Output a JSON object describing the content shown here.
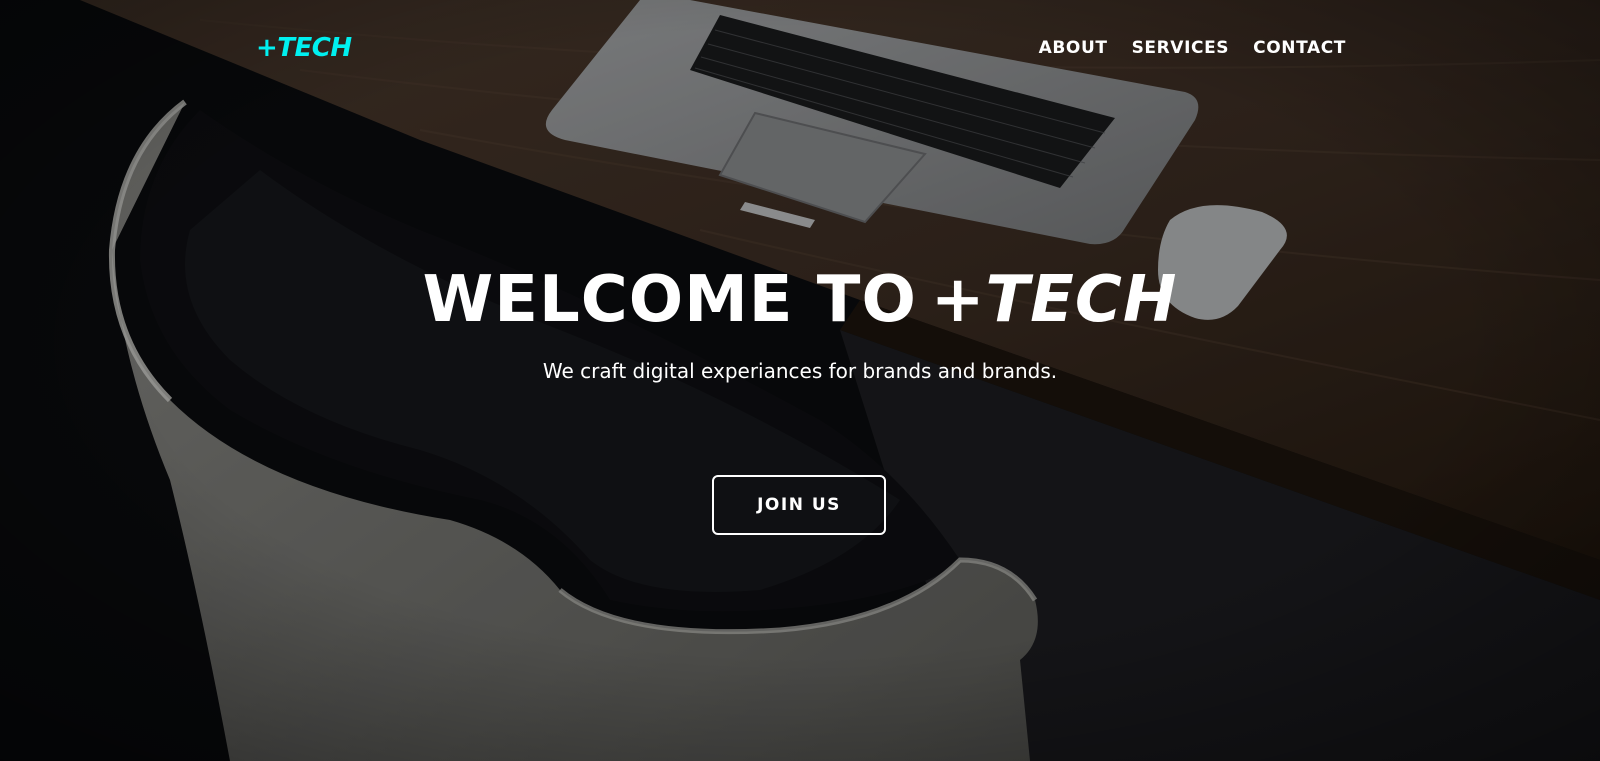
{
  "header": {
    "logo": "+TECH",
    "logo_color": "#00f0f0",
    "nav": [
      {
        "label": "ABOUT"
      },
      {
        "label": "SERVICES"
      },
      {
        "label": "CONTACT"
      }
    ]
  },
  "hero": {
    "title_prefix": "WELCOME TO",
    "title_brand": "+TECH",
    "subtitle": "We craft digital experiances for brands and brands.",
    "cta_label": "JOIN US"
  },
  "colors": {
    "text": "#ffffff",
    "accent": "#00f0f0",
    "overlay": "#0b0c0e"
  }
}
